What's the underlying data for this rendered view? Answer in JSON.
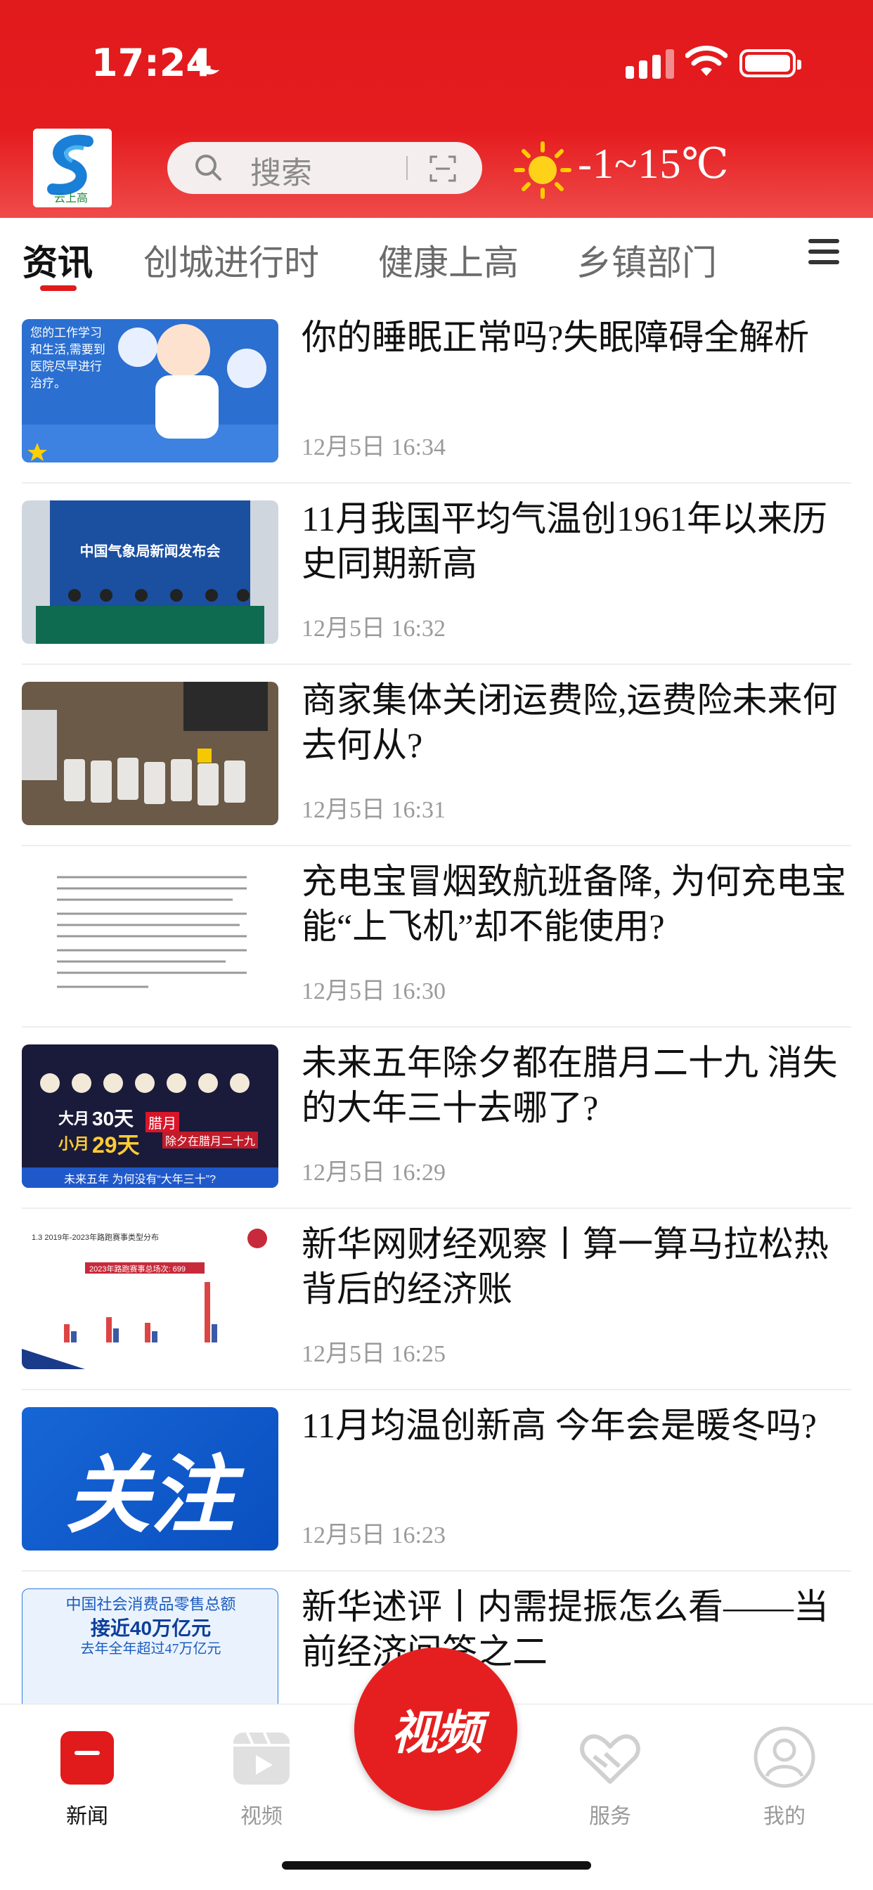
{
  "status_bar": {
    "time": "17:24"
  },
  "header": {
    "search_placeholder": "搜索",
    "weather": "-1~15℃",
    "colors": {
      "brand_red": "#e11a1c"
    }
  },
  "tabs": [
    {
      "label": "资讯",
      "active": true
    },
    {
      "label": "创城进行时",
      "active": false
    },
    {
      "label": "健康上高",
      "active": false
    },
    {
      "label": "乡镇部门",
      "active": false
    }
  ],
  "thumb_text": {
    "t1": "您的工作学习和生活,需要到医院尽早进行治疗。",
    "t2": "中国气象局新闻发布会",
    "t5a": "大月",
    "t5b": "30天",
    "t5c": "小月",
    "t5d": "29天",
    "t5e": "腊月",
    "t5f": "除夕在腊月二十九",
    "t5g": "未来五年 为何没有“大年三十”?",
    "t6a": "1.3 2019年-2023年路跑赛事类型分布",
    "t6b": "2023年路跑赛事总场次: 699",
    "t7": "关注",
    "t8a": "中国社会消费品零售总额",
    "t8b": "接近40万亿元",
    "t8c": "去年全年超过47万亿元"
  },
  "news": [
    {
      "title": "你的睡眠正常吗?失眠障碍全解析",
      "time": "12月5日  16:34"
    },
    {
      "title": "11月我国平均气温创1961年以来历史同期新高",
      "time": "12月5日  16:32"
    },
    {
      "title": "商家集体关闭运费险,运费险未来何去何从?",
      "time": "12月5日  16:31"
    },
    {
      "title": "充电宝冒烟致航班备降, 为何充电宝能“上飞机”却不能使用?",
      "time": "12月5日  16:30"
    },
    {
      "title": "未来五年除夕都在腊月二十九 消失的大年三十去哪了?",
      "time": "12月5日  16:29"
    },
    {
      "title": "新华网财经观察丨算一算马拉松热背后的经济账",
      "time": "12月5日  16:25"
    },
    {
      "title": "11月均温创新高 今年会是暖冬吗?",
      "time": "12月5日  16:23"
    },
    {
      "title": "新华述评丨内需提振怎么看——当前经济问答之二",
      "time": ""
    }
  ],
  "bottom_nav": [
    {
      "label": "新闻",
      "icon": "news-icon",
      "active": true
    },
    {
      "label": "视频",
      "icon": "video-icon",
      "active": false
    },
    {
      "label": "服务",
      "icon": "service-icon",
      "active": false
    },
    {
      "label": "我的",
      "icon": "profile-icon",
      "active": false
    }
  ],
  "fab_label": "视频"
}
